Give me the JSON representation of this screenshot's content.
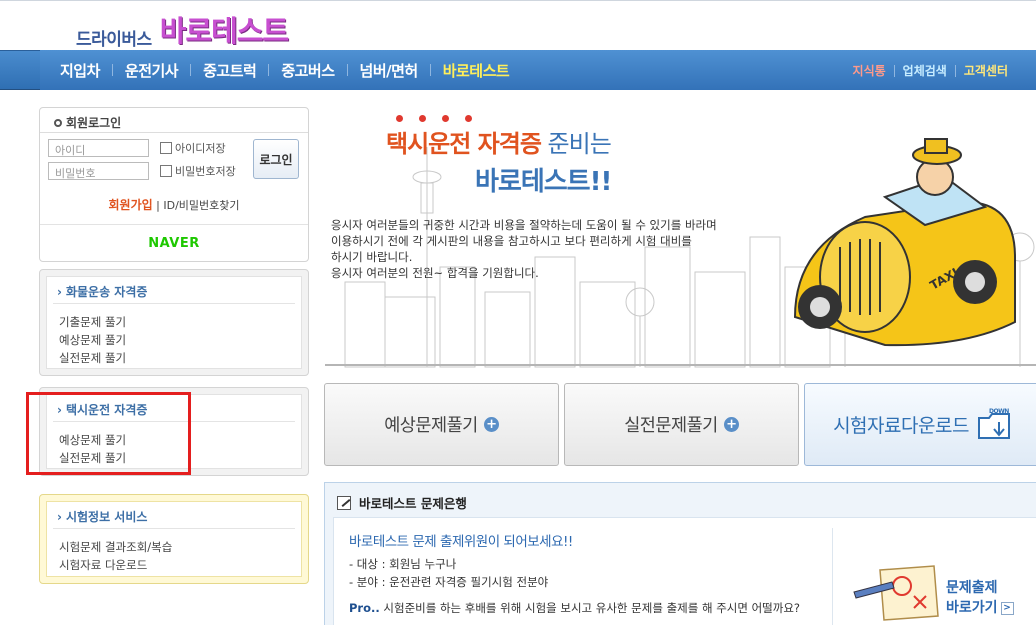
{
  "header": {
    "logo_sub": "드라이버스",
    "logo_main": "바로테스트"
  },
  "nav": {
    "items": [
      "지입차",
      "운전기사",
      "중고트럭",
      "중고버스",
      "넘버/면허",
      "바로테스트"
    ],
    "right": [
      "지식통",
      "업체검색",
      "고객센터"
    ]
  },
  "login": {
    "title": "회원로그인",
    "id_placeholder": "아이디",
    "pw_placeholder": "비밀번호",
    "save_id": "아이디저장",
    "save_pw": "비밀번호저장",
    "login_button": "로그인",
    "join": "회원가입",
    "sep": " | ",
    "find": "ID/비밀번호찾기",
    "naver": "NAVER"
  },
  "sidebar": {
    "cargo": {
      "title": "화물운송 자격증",
      "items": [
        "기출문제 풀기",
        "예상문제 풀기",
        "실전문제 풀기"
      ]
    },
    "taxi": {
      "title": "택시운전 자격증",
      "items": [
        "예상문제 풀기",
        "실전문제 풀기"
      ]
    },
    "exam": {
      "title": "시험정보 서비스",
      "items": [
        "시험문제 결과조회/복습",
        "시험자료 다운로드"
      ]
    }
  },
  "banner": {
    "title_red": "택시운전 자격증",
    "title_blue": " 준비는",
    "title2": "바로테스트!!",
    "text": [
      "응시자 여러분들의 귀중한 시간과 비용을 절약하는데 도움이 될 수 있기를 바라며",
      "이용하시기 전에 각 게시판의 내용을 참고하시고 보다 편리하게 시험 대비를",
      "하시기 바랍니다.",
      "응시자 여러분의 전원~ 합격을 기원합니다."
    ],
    "taxi_sign": "TAXI"
  },
  "actions": {
    "predict": "예상문제풀기",
    "practice": "실전문제풀기",
    "download": "시험자료다운로드",
    "download_badge": "DOWN",
    "plus": "+"
  },
  "bank": {
    "title": "바로테스트 문제은행",
    "headline": "바로테스트 문제 출제위원이 되어보세요!!",
    "target": "- 대상 : 회원님 누구나",
    "field": "- 분야 : 운전관련 자격증 필기시험 전분야",
    "pro_label": "Pro..",
    "pro_text": " 시험준비를 하는 후배를 위해 시험을 보시고 유사한 문제를 출제를 해 주시면 어떨까요?",
    "go_line1": "문제출제",
    "go_line2": "바로가기",
    "go_arrow": ">"
  }
}
